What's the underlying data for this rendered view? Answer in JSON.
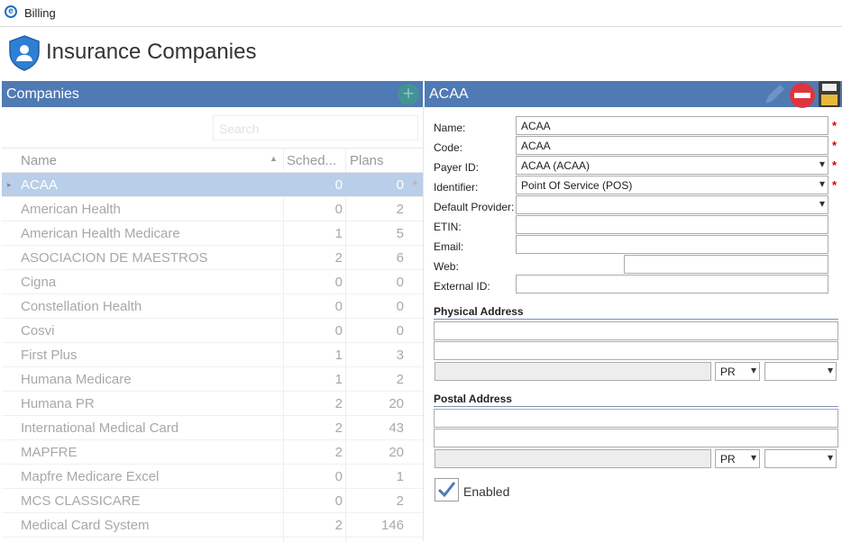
{
  "window": {
    "title": "Billing"
  },
  "page": {
    "title": "Insurance Companies"
  },
  "companies_panel": {
    "header": "Companies",
    "add_button": "+",
    "search_placeholder": "Search",
    "columns": [
      "Name",
      "Sched...",
      "Plans"
    ],
    "rows": [
      {
        "name": "ACAA",
        "sched": "0",
        "plans": "0",
        "selected": true
      },
      {
        "name": "American Health",
        "sched": "0",
        "plans": "2"
      },
      {
        "name": "American Health Medicare",
        "sched": "1",
        "plans": "5"
      },
      {
        "name": "ASOCIACION DE MAESTROS",
        "sched": "2",
        "plans": "6"
      },
      {
        "name": "Cigna",
        "sched": "0",
        "plans": "0"
      },
      {
        "name": "Constellation Health",
        "sched": "0",
        "plans": "0"
      },
      {
        "name": "Cosvi",
        "sched": "0",
        "plans": "0"
      },
      {
        "name": "First Plus",
        "sched": "1",
        "plans": "3"
      },
      {
        "name": "Humana Medicare",
        "sched": "1",
        "plans": "2"
      },
      {
        "name": "Humana PR",
        "sched": "2",
        "plans": "20"
      },
      {
        "name": "International Medical Card",
        "sched": "2",
        "plans": "43"
      },
      {
        "name": "MAPFRE",
        "sched": "2",
        "plans": "20"
      },
      {
        "name": "Mapfre Medicare Excel",
        "sched": "0",
        "plans": "1"
      },
      {
        "name": "MCS CLASSICARE",
        "sched": "0",
        "plans": "2"
      },
      {
        "name": "Medical Card System",
        "sched": "2",
        "plans": "146"
      }
    ]
  },
  "detail": {
    "header": "ACAA",
    "labels": {
      "name": "Name:",
      "code": "Code:",
      "payer_id": "Payer ID:",
      "identifier": "Identifier:",
      "default_provider": "Default Provider:",
      "etin": "ETIN:",
      "email": "Email:",
      "web": "Web:",
      "external_id": "External ID:"
    },
    "values": {
      "name": "ACAA",
      "code": "ACAA",
      "payer_id": "ACAA (ACAA)",
      "identifier": "Point Of Service (POS)",
      "default_provider": "",
      "etin": "",
      "email": "",
      "web": "",
      "external_id": ""
    },
    "required_mark": "*",
    "physical_address": {
      "title": "Physical Address",
      "state": "PR"
    },
    "postal_address": {
      "title": "Postal Address",
      "state": "PR"
    },
    "enabled": {
      "label": "Enabled",
      "checked": true
    }
  },
  "colors": {
    "header_blue": "#4f7ab4",
    "selected_row": "#b9cee8",
    "required": "#dd0000"
  }
}
